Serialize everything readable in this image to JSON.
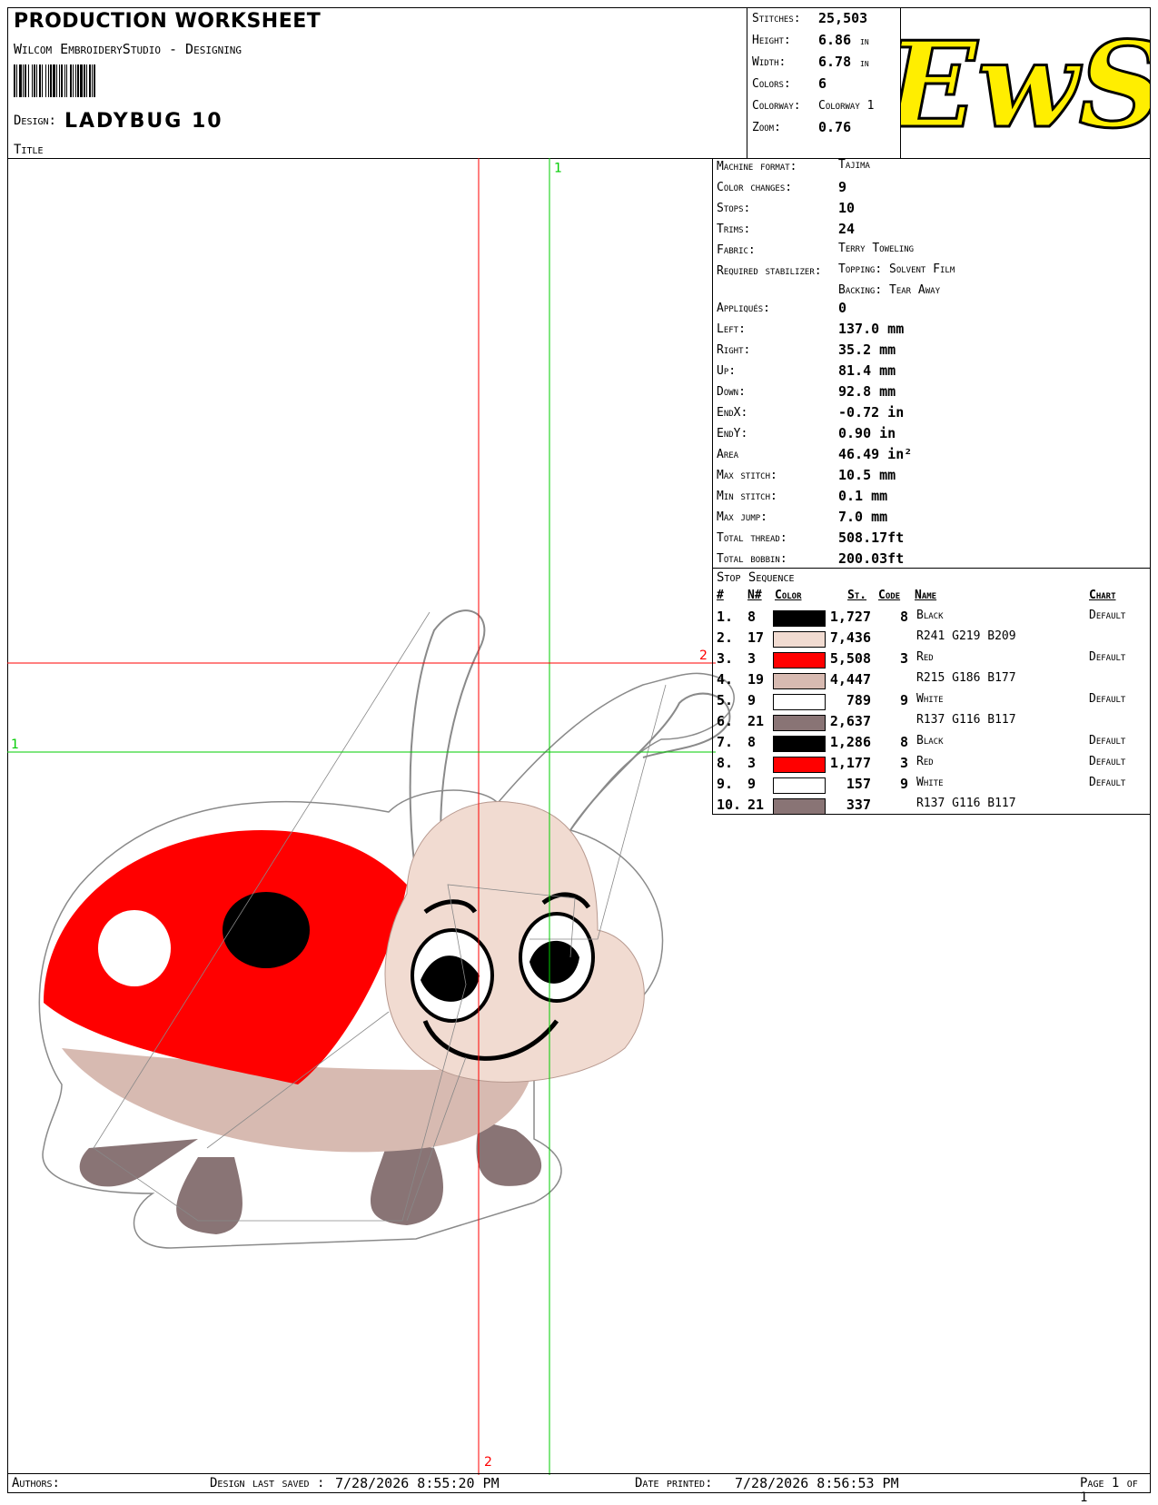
{
  "header": {
    "title": "PRODUCTION WORKSHEET",
    "software": "Wilcom EmbroideryStudio - Designing",
    "design_label": "Design:",
    "design_value": "LADYBUG 10",
    "title_label": "Title"
  },
  "summary": {
    "stitches_label": "Stitches:",
    "stitches": "25,503",
    "height_label": "Height:",
    "height": "6.86",
    "height_unit": "in",
    "width_label": "Width:",
    "width": "6.78",
    "width_unit": "in",
    "colors_label": "Colors:",
    "colors": "6",
    "colorway_label": "Colorway:",
    "colorway": "Colorway 1",
    "zoom_label": "Zoom:",
    "zoom": "0.76"
  },
  "logo": {
    "text": "EwS",
    "fill": "#ffee00"
  },
  "details": [
    {
      "label": "Machine format:",
      "value": "Tajima"
    },
    {
      "label": "Color changes:",
      "value": "9"
    },
    {
      "label": "Stops:",
      "value": "10"
    },
    {
      "label": "Trims:",
      "value": "24"
    },
    {
      "label": "Fabric:",
      "value": "Terry Toweling"
    },
    {
      "label": "Required stabilizer:",
      "value": "Topping: Solvent Film"
    },
    {
      "label": "",
      "value": "Backing: Tear Away"
    },
    {
      "label": "Appliqués:",
      "value": "0"
    },
    {
      "label": "Left:",
      "value": "137.0 mm"
    },
    {
      "label": "Right:",
      "value": "35.2 mm"
    },
    {
      "label": "Up:",
      "value": "81.4 mm"
    },
    {
      "label": "Down:",
      "value": "92.8 mm"
    },
    {
      "label": "EndX:",
      "value": "-0.72 in"
    },
    {
      "label": "EndY:",
      "value": "0.90 in"
    },
    {
      "label": "Area",
      "value": "46.49 in²"
    },
    {
      "label": "Max stitch:",
      "value": "10.5 mm"
    },
    {
      "label": "Min stitch:",
      "value": "0.1 mm"
    },
    {
      "label": "Max jump:",
      "value": "7.0 mm"
    },
    {
      "label": "Total thread:",
      "value": "508.17ft"
    },
    {
      "label": "Total bobbin:",
      "value": "200.03ft"
    }
  ],
  "sequence": {
    "title": "Stop Sequence",
    "headers": [
      "#",
      "N#",
      "Color",
      "St.",
      "Code",
      "Name",
      "Chart"
    ],
    "rows": [
      {
        "n": "1.",
        "needle": "8",
        "color": "#000000",
        "stitches": "1,727",
        "code": "8",
        "name": "Black",
        "chart": "Default"
      },
      {
        "n": "2.",
        "needle": "17",
        "color": "#f1dbd1",
        "stitches": "7,436",
        "code": "",
        "name": "R241 G219 B209",
        "chart": ""
      },
      {
        "n": "3.",
        "needle": "3",
        "color": "#ff0000",
        "stitches": "5,508",
        "code": "3",
        "name": "Red",
        "chart": "Default"
      },
      {
        "n": "4.",
        "needle": "19",
        "color": "#d7bab1",
        "stitches": "4,447",
        "code": "",
        "name": "R215 G186 B177",
        "chart": ""
      },
      {
        "n": "5.",
        "needle": "9",
        "color": "#ffffff",
        "stitches": "789",
        "code": "9",
        "name": "White",
        "chart": "Default"
      },
      {
        "n": "6.",
        "needle": "21",
        "color": "#897475",
        "stitches": "2,637",
        "code": "",
        "name": "R137 G116 B117",
        "chart": ""
      },
      {
        "n": "7.",
        "needle": "8",
        "color": "#000000",
        "stitches": "1,286",
        "code": "8",
        "name": "Black",
        "chart": "Default"
      },
      {
        "n": "8.",
        "needle": "3",
        "color": "#ff0000",
        "stitches": "1,177",
        "code": "3",
        "name": "Red",
        "chart": "Default"
      },
      {
        "n": "9.",
        "needle": "9",
        "color": "#ffffff",
        "stitches": "157",
        "code": "9",
        "name": "White",
        "chart": "Default"
      },
      {
        "n": "10.",
        "needle": "21",
        "color": "#897475",
        "stitches": "337",
        "code": "",
        "name": "R137 G116 B117",
        "chart": ""
      }
    ]
  },
  "axes": {
    "v1": "1",
    "h2": "2",
    "h1": "1",
    "v2": "2",
    "colors": {
      "red": "#ff0000",
      "green": "#00cc00"
    }
  },
  "footer": {
    "authors_label": "Authors:",
    "saved_label": "Design last saved :",
    "saved_value": "7/28/2026 8:55:20 PM",
    "printed_label": "Date printed:",
    "printed_value": "7/28/2026 8:56:53 PM",
    "page": "Page 1 of 1"
  }
}
